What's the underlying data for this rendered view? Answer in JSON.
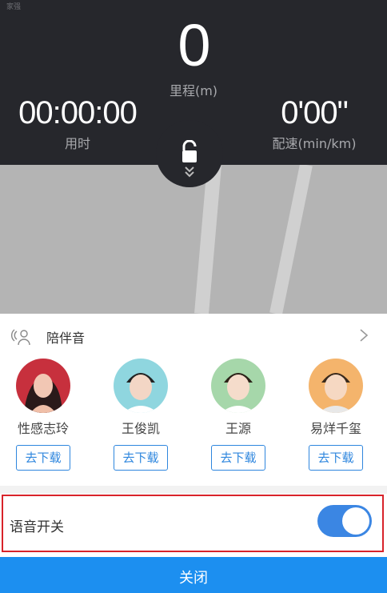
{
  "stats": {
    "tiny_label": "家强",
    "distance_value": "0",
    "distance_label": "里程(m)",
    "time_value": "00:00:00",
    "time_label": "用时",
    "pace_value": "0'00\"",
    "pace_label": "配速(min/km)"
  },
  "companion": {
    "title": "陪伴音",
    "voices": [
      {
        "name": "性感志玲",
        "button": "去下载",
        "avatar_color": "#d96a7a"
      },
      {
        "name": "王俊凯",
        "button": "去下载",
        "avatar_color": "#8fd3de"
      },
      {
        "name": "王源",
        "button": "去下载",
        "avatar_color": "#9fd2a6"
      },
      {
        "name": "易烊千玺",
        "button": "去下载",
        "avatar_color": "#f3b26a"
      }
    ]
  },
  "voice_switch": {
    "label": "语音开关",
    "enabled": true
  },
  "footer": {
    "close_label": "关闭"
  },
  "colors": {
    "panel_dark": "#26272c",
    "accent_blue": "#1c8ff0",
    "highlight_red": "#d8232a",
    "map_gray": "#b4b4b4"
  }
}
